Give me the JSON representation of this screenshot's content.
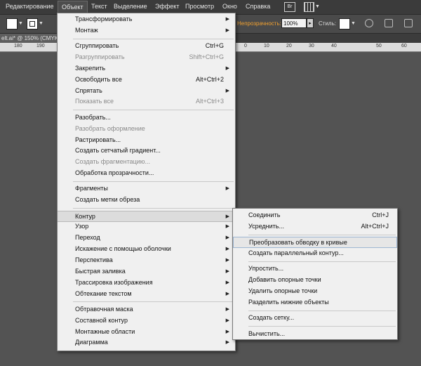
{
  "menubar": {
    "items": [
      "Редактирование",
      "Объект",
      "Текст",
      "Выделение",
      "Эффект",
      "Просмотр",
      "Окно",
      "Справка"
    ],
    "bridge_label": "Br"
  },
  "control_bar": {
    "opacity_label": "Непрозрачность:",
    "opacity_value": "100%",
    "styles_label": "Стиль:"
  },
  "document_tab": "elt.ai* @ 150% (CMYK",
  "ruler": [
    "180",
    "190",
    "0",
    "10",
    "20",
    "30",
    "40",
    "50",
    "60"
  ],
  "object_menu": {
    "groups": [
      [
        {
          "label": "Трансформировать",
          "shortcut": "",
          "submenu": true,
          "disabled": false
        },
        {
          "label": "Монтаж",
          "shortcut": "",
          "submenu": true,
          "disabled": false
        }
      ],
      [
        {
          "label": "Сгруппировать",
          "shortcut": "Ctrl+G",
          "submenu": false,
          "disabled": false
        },
        {
          "label": "Разгруппировать",
          "shortcut": "Shift+Ctrl+G",
          "submenu": false,
          "disabled": true
        },
        {
          "label": "Закрепить",
          "shortcut": "",
          "submenu": true,
          "disabled": false
        },
        {
          "label": "Освободить все",
          "shortcut": "Alt+Ctrl+2",
          "submenu": false,
          "disabled": false
        },
        {
          "label": "Спрятать",
          "shortcut": "",
          "submenu": true,
          "disabled": false
        },
        {
          "label": "Показать все",
          "shortcut": "Alt+Ctrl+3",
          "submenu": false,
          "disabled": true
        }
      ],
      [
        {
          "label": "Разобрать...",
          "shortcut": "",
          "submenu": false,
          "disabled": false
        },
        {
          "label": "Разобрать оформление",
          "shortcut": "",
          "submenu": false,
          "disabled": true
        },
        {
          "label": "Растрировать...",
          "shortcut": "",
          "submenu": false,
          "disabled": false
        },
        {
          "label": "Создать сетчатый градиент...",
          "shortcut": "",
          "submenu": false,
          "disabled": false
        },
        {
          "label": "Создать фрагментацию...",
          "shortcut": "",
          "submenu": false,
          "disabled": true
        },
        {
          "label": "Обработка прозрачности...",
          "shortcut": "",
          "submenu": false,
          "disabled": false
        }
      ],
      [
        {
          "label": "Фрагменты",
          "shortcut": "",
          "submenu": true,
          "disabled": false
        },
        {
          "label": "Создать метки обреза",
          "shortcut": "",
          "submenu": false,
          "disabled": false
        }
      ],
      [
        {
          "label": "Контур",
          "shortcut": "",
          "submenu": true,
          "disabled": false,
          "active": true
        },
        {
          "label": "Узор",
          "shortcut": "",
          "submenu": true,
          "disabled": false
        },
        {
          "label": "Переход",
          "shortcut": "",
          "submenu": true,
          "disabled": false
        },
        {
          "label": "Искажение с помощью оболочки",
          "shortcut": "",
          "submenu": true,
          "disabled": false
        },
        {
          "label": "Перспектива",
          "shortcut": "",
          "submenu": true,
          "disabled": false
        },
        {
          "label": "Быстрая заливка",
          "shortcut": "",
          "submenu": true,
          "disabled": false
        },
        {
          "label": "Трассировка изображения",
          "shortcut": "",
          "submenu": true,
          "disabled": false
        },
        {
          "label": "Обтекание текстом",
          "shortcut": "",
          "submenu": true,
          "disabled": false
        }
      ],
      [
        {
          "label": "Обтравочная маска",
          "shortcut": "",
          "submenu": true,
          "disabled": false
        },
        {
          "label": "Составной контур",
          "shortcut": "",
          "submenu": true,
          "disabled": false
        },
        {
          "label": "Монтажные области",
          "shortcut": "",
          "submenu": true,
          "disabled": false
        },
        {
          "label": "Диаграмма",
          "shortcut": "",
          "submenu": true,
          "disabled": false
        }
      ]
    ]
  },
  "path_submenu": {
    "groups": [
      [
        {
          "label": "Соединить",
          "shortcut": "Ctrl+J"
        },
        {
          "label": "Усреднить...",
          "shortcut": "Alt+Ctrl+J"
        }
      ],
      [
        {
          "label": "Преобразовать обводку в кривые",
          "shortcut": "",
          "highlighted": true
        },
        {
          "label": "Создать параллельный контур...",
          "shortcut": ""
        }
      ],
      [
        {
          "label": "Упростить...",
          "shortcut": ""
        },
        {
          "label": "Добавить опорные точки",
          "shortcut": ""
        },
        {
          "label": "Удалить опорные точки",
          "shortcut": ""
        },
        {
          "label": "Разделить нижние объекты",
          "shortcut": ""
        }
      ],
      [
        {
          "label": "Создать сетку...",
          "shortcut": ""
        }
      ],
      [
        {
          "label": "Вычистить...",
          "shortcut": ""
        }
      ]
    ]
  }
}
